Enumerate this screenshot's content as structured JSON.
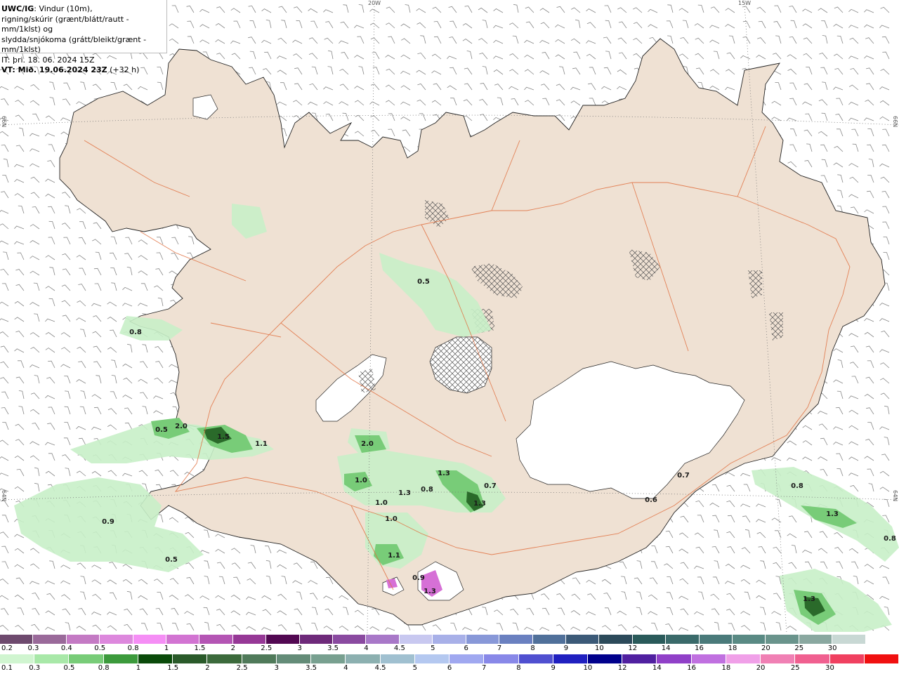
{
  "header": {
    "model": "UWC/IG",
    "title_rest": ": Vindur (10m),",
    "line2": "rigning/skúrir (grænt/blátt/rautt - mm/1klst) og",
    "line3": "slydda/snjókoma (grátt/bleikt/grænt - mm/1klst)",
    "it": "IT: þri. 18. 06. 2024 15Z",
    "vt_bold": "VT: Mið. 19.06.2024 23Z",
    "vt_rest": " (+32 h)"
  },
  "coordinates": {
    "lon_20w": "20W",
    "lon_15w": "15W",
    "lat_66n_left": "66N",
    "lat_66n_right": "66N",
    "lat_64n_left": "64N",
    "lat_64n_right": "64N"
  },
  "precip_labels": [
    "0.8",
    "0.5",
    "2.0",
    "1.5",
    "1.1",
    "2.0",
    "0.5",
    "1.0",
    "1.3",
    "0.8",
    "0.7",
    "1.3",
    "1.0",
    "1.3",
    "1.0",
    "1.1",
    "0.9",
    "0.5",
    "0.6",
    "0.7",
    "0.8",
    "1.3",
    "0.8",
    "1.3",
    "0.9",
    "1.3"
  ],
  "legend_snow": {
    "labels": [
      "0.2",
      "0.3",
      "0.4",
      "0.5",
      "0.8",
      "1",
      "1.5",
      "2",
      "2.5",
      "3",
      "3.5",
      "4",
      "4.5",
      "5",
      "6",
      "7",
      "8",
      "9",
      "10",
      "12",
      "14",
      "16",
      "18",
      "20",
      "25",
      "30"
    ],
    "colors": [
      "#6e4a6e",
      "#9a6a9a",
      "#c47ac4",
      "#dd88dd",
      "#f58ef5",
      "#d274d2",
      "#b455b4",
      "#963896",
      "#520852",
      "#6e2a7a",
      "#8a4aa0",
      "#a878c8",
      "#c8c8f0",
      "#a8b0e8",
      "#8898d8",
      "#6a80c0",
      "#50709a",
      "#3c5a78",
      "#2c4a5a",
      "#2a5a5a",
      "#3a6a6a",
      "#4a7a7a",
      "#5a8a84",
      "#6a948c",
      "#8aa8a0",
      "#c8d8d4",
      "#ffffff"
    ]
  },
  "legend_rain": {
    "labels": [
      "0.1",
      "0.3",
      "0.5",
      "0.8",
      "1",
      "1.5",
      "2",
      "2.5",
      "3",
      "3.5",
      "4",
      "4.5",
      "5",
      "6",
      "7",
      "8",
      "9",
      "10",
      "12",
      "14",
      "16",
      "18",
      "20",
      "25",
      "30"
    ],
    "colors": [
      "#d0f5d0",
      "#a8e8a8",
      "#78cc78",
      "#3c9a3c",
      "#0a4a0a",
      "#2a5a2a",
      "#3c6a3c",
      "#507a5a",
      "#648c78",
      "#78a090",
      "#8cb0b0",
      "#a0c0d0",
      "#b4c8f0",
      "#a0a8f0",
      "#8888e8",
      "#5050d0",
      "#2020c0",
      "#00008c",
      "#5020a0",
      "#9040c8",
      "#c070e0",
      "#f0a0e8",
      "#f080b4",
      "#f06090",
      "#f04060",
      "#f01010"
    ]
  }
}
